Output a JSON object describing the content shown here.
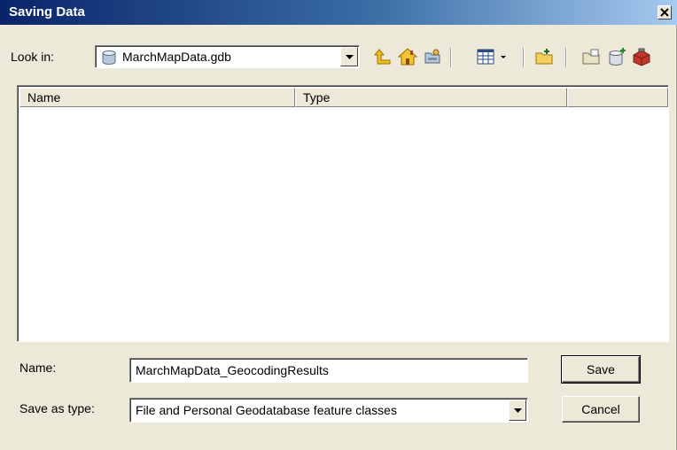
{
  "window": {
    "title": "Saving Data"
  },
  "lookin": {
    "label": "Look in:",
    "value": "MarchMapData.gdb"
  },
  "toolbar": {
    "icons": [
      "up-one-level-icon",
      "home-icon",
      "connect-folder-icon",
      "view-menu-icon",
      "new-folder-icon",
      "new-file-geodatabase-icon",
      "new-personal-geodatabase-icon",
      "toolbox-icon"
    ]
  },
  "list": {
    "columns": [
      "Name",
      "Type",
      ""
    ]
  },
  "form": {
    "name_label": "Name:",
    "name_value": "MarchMapData_GeocodingResults",
    "type_label": "Save as type:",
    "type_value": "File and Personal Geodatabase feature classes"
  },
  "buttons": {
    "save": "Save",
    "cancel": "Cancel"
  },
  "colors": {
    "title_start": "#0a246a",
    "title_end": "#a6caf0",
    "face": "#ece9d8"
  }
}
